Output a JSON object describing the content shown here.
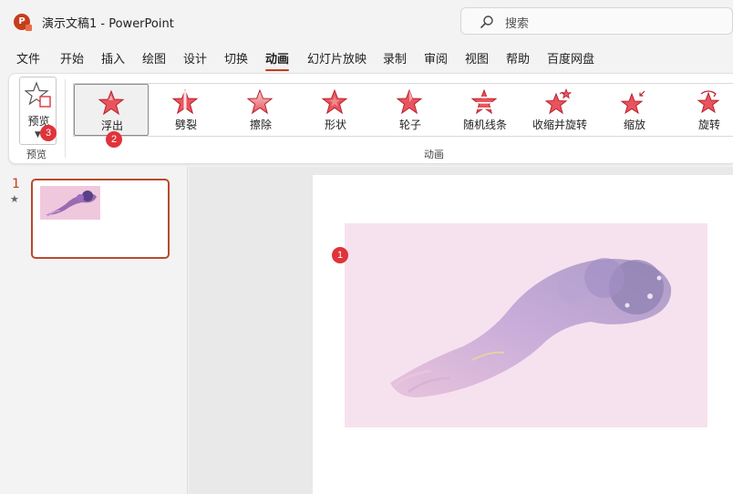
{
  "window": {
    "app_icon_letter": "P",
    "title": "演示文稿1  -  PowerPoint",
    "search_placeholder": "搜索"
  },
  "menu": {
    "tabs": [
      "文件",
      "开始",
      "插入",
      "绘图",
      "设计",
      "切换",
      "动画",
      "幻灯片放映",
      "录制",
      "审阅",
      "视图",
      "帮助",
      "百度网盘"
    ],
    "active_tab": "动画"
  },
  "ribbon": {
    "preview": {
      "button_label": "预览",
      "group_label": "预览",
      "icon": "star-preview-icon"
    },
    "animations": {
      "group_label": "动画",
      "items": [
        {
          "label": "浮出",
          "icon": "fly-in-star-icon",
          "selected": true
        },
        {
          "label": "劈裂",
          "icon": "split-star-icon"
        },
        {
          "label": "擦除",
          "icon": "wipe-star-icon"
        },
        {
          "label": "形状",
          "icon": "shape-star-icon"
        },
        {
          "label": "轮子",
          "icon": "wheel-star-icon"
        },
        {
          "label": "随机线条",
          "icon": "random-bars-star-icon"
        },
        {
          "label": "收缩并旋转",
          "icon": "shrink-turn-star-icon"
        },
        {
          "label": "缩放",
          "icon": "zoom-star-icon"
        },
        {
          "label": "旋转",
          "icon": "spin-star-icon"
        }
      ]
    }
  },
  "badges": {
    "slide_image": "1",
    "fly_in": "2",
    "preview": "3"
  },
  "thumbnails": {
    "slide_number": "1",
    "animation_marker": "★"
  },
  "colors": {
    "accent": "#c43e1c",
    "badge": "#e0333a",
    "star_fill": "#e8545e",
    "image_bg": "#f6e2ee"
  }
}
